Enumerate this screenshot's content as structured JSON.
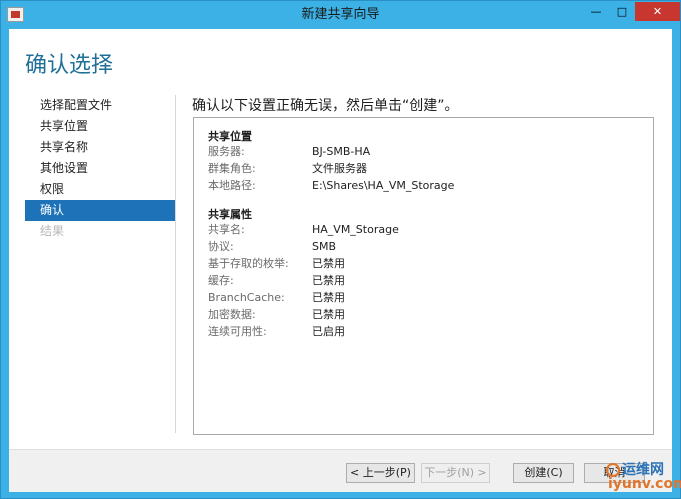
{
  "window": {
    "title": "新建共享向导"
  },
  "page": {
    "title": "确认选择",
    "instruction": "确认以下设置正确无误，然后单击“创建”。"
  },
  "nav": {
    "items": [
      {
        "label": "选择配置文件",
        "state": "normal"
      },
      {
        "label": "共享位置",
        "state": "normal"
      },
      {
        "label": "共享名称",
        "state": "normal"
      },
      {
        "label": "其他设置",
        "state": "normal"
      },
      {
        "label": "权限",
        "state": "normal"
      },
      {
        "label": "确认",
        "state": "active"
      },
      {
        "label": "结果",
        "state": "disabled"
      }
    ]
  },
  "summary": {
    "location": {
      "title": "共享位置",
      "rows": [
        {
          "key": "服务器:",
          "value": "BJ-SMB-HA"
        },
        {
          "key": "群集角色:",
          "value": "文件服务器"
        },
        {
          "key": "本地路径:",
          "value": "E:\\Shares\\HA_VM_Storage"
        }
      ]
    },
    "properties": {
      "title": "共享属性",
      "rows": [
        {
          "key": "共享名:",
          "value": "HA_VM_Storage"
        },
        {
          "key": "协议:",
          "value": "SMB"
        },
        {
          "key": "基于存取的枚举:",
          "value": "已禁用"
        },
        {
          "key": "缓存:",
          "value": "已禁用"
        },
        {
          "key": "BranchCache:",
          "value": "已禁用"
        },
        {
          "key": "加密数据:",
          "value": "已禁用"
        },
        {
          "key": "连续可用性:",
          "value": "已启用"
        }
      ]
    }
  },
  "footer": {
    "prev_label": "< 上一步(P)",
    "next_label": "下一步(N) >",
    "create_label": "创建(C)",
    "cancel_label": "取消"
  },
  "watermark": {
    "cn": "运维网",
    "en": "iyunv.com"
  },
  "colors": {
    "title_bar": "#3cb1e6",
    "accent": "#1d72b8",
    "heading": "#1f6f98",
    "close_button": "#c7372f"
  }
}
